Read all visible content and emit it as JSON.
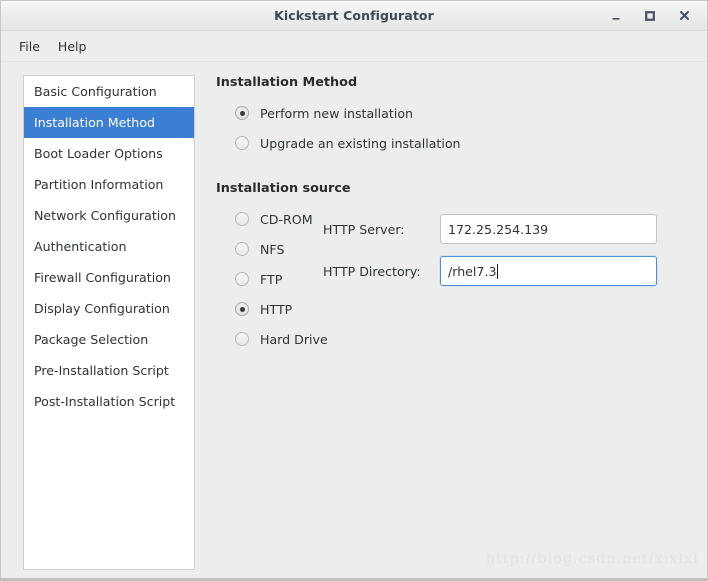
{
  "window": {
    "title": "Kickstart Configurator",
    "controls": [
      {
        "name": "minimize",
        "glyph": "minimize-icon"
      },
      {
        "name": "maximize",
        "glyph": "maximize-icon"
      },
      {
        "name": "close",
        "glyph": "close-icon"
      }
    ]
  },
  "menubar": {
    "items": [
      {
        "label": "File"
      },
      {
        "label": "Help"
      }
    ]
  },
  "sidebar": {
    "items": [
      {
        "label": "Basic Configuration",
        "selected": false
      },
      {
        "label": "Installation Method",
        "selected": true
      },
      {
        "label": "Boot Loader Options",
        "selected": false
      },
      {
        "label": "Partition Information",
        "selected": false
      },
      {
        "label": "Network Configuration",
        "selected": false
      },
      {
        "label": "Authentication",
        "selected": false
      },
      {
        "label": "Firewall Configuration",
        "selected": false
      },
      {
        "label": "Display Configuration",
        "selected": false
      },
      {
        "label": "Package Selection",
        "selected": false
      },
      {
        "label": "Pre-Installation Script",
        "selected": false
      },
      {
        "label": "Post-Installation Script",
        "selected": false
      }
    ]
  },
  "main": {
    "method_section": {
      "title": "Installation Method",
      "options": [
        {
          "label": "Perform new installation",
          "checked": true
        },
        {
          "label": "Upgrade an existing installation",
          "checked": false
        }
      ]
    },
    "source_section": {
      "title": "Installation source",
      "options": [
        {
          "label": "CD-ROM",
          "checked": false
        },
        {
          "label": "NFS",
          "checked": false
        },
        {
          "label": "FTP",
          "checked": false
        },
        {
          "label": "HTTP",
          "checked": true
        },
        {
          "label": "Hard Drive",
          "checked": false
        }
      ]
    },
    "fields": [
      {
        "label": "HTTP Server:",
        "value": "172.25.254.139",
        "placeholder": "",
        "focused": false
      },
      {
        "label": "HTTP Directory:",
        "value": "/rhel7.3",
        "placeholder": "",
        "focused": true
      }
    ]
  },
  "watermark": {
    "text": "http://blog.csdn.net/xixlxl"
  },
  "colors": {
    "selection": "#3b7fd4",
    "focus_border": "#4a90d9",
    "window_bg": "#ededed",
    "panel_bg": "#ffffff",
    "title_text": "#3c4a55"
  }
}
